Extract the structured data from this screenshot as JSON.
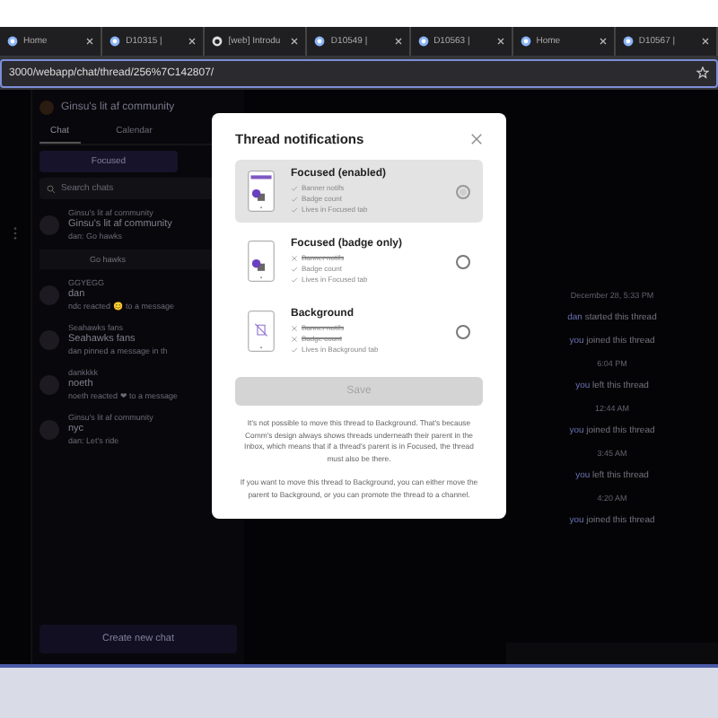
{
  "browser": {
    "tabs": [
      {
        "label": "Home",
        "kind": "app",
        "selected": false
      },
      {
        "label": "D10315 |",
        "kind": "app",
        "selected": false
      },
      {
        "label": "[web] Introdu",
        "kind": "github",
        "selected": false
      },
      {
        "label": "D10549 |",
        "kind": "app",
        "selected": false
      },
      {
        "label": "D10563 |",
        "kind": "app",
        "selected": false
      },
      {
        "label": "Home",
        "kind": "app",
        "selected": false
      },
      {
        "label": "D10567 |",
        "kind": "app",
        "selected": false
      }
    ],
    "address": "3000/webapp/chat/thread/256%7C142807/"
  },
  "sidebar": {
    "community": "Ginsu's lit af community",
    "tabs": [
      {
        "label": "Chat",
        "selected": true
      },
      {
        "label": "Calendar",
        "selected": false
      }
    ],
    "filter": "Focused",
    "search": {
      "placeholder": "Search chats"
    },
    "chats": [
      {
        "community": "Ginsu's lit af community",
        "name": "Ginsu's lit af community",
        "preview": "dan: Go hawks",
        "thread": "Go hawks"
      },
      {
        "community": "GGYEGG",
        "name": "dan",
        "preview": "ndc reacted 😊 to a message"
      },
      {
        "community": "Seahawks fans",
        "name": "Seahawks fans",
        "preview": "dan pinned a message in th"
      },
      {
        "community": "dankkkk",
        "name": "noeth",
        "preview": "noeth reacted ❤ to a message"
      },
      {
        "community": "Ginsu's lit af community",
        "name": "nyc",
        "preview": "dan: Let's ride"
      }
    ],
    "create_button": "Create new chat"
  },
  "thread": {
    "events": [
      {
        "kind": "time",
        "text": "December 28, 5:33 PM"
      },
      {
        "kind": "action",
        "actor": "dan",
        "text": "started this thread"
      },
      {
        "kind": "action",
        "actor": "you",
        "text": "joined this thread"
      },
      {
        "kind": "time",
        "text": "6:04 PM"
      },
      {
        "kind": "action",
        "actor": "you",
        "text": "left this thread"
      },
      {
        "kind": "time",
        "text": "12:44 AM"
      },
      {
        "kind": "action",
        "actor": "you",
        "text": "joined this thread"
      },
      {
        "kind": "time",
        "text": "3:45 AM"
      },
      {
        "kind": "action",
        "actor": "you",
        "text": "left this thread"
      },
      {
        "kind": "time",
        "text": "4:20 AM"
      },
      {
        "kind": "action",
        "actor": "you",
        "text": "joined this thread"
      }
    ]
  },
  "modal": {
    "title": "Thread notifications",
    "options": [
      {
        "kind": "focused",
        "title": "Focused (enabled)",
        "selected": true,
        "features": [
          {
            "text": "Banner notifs",
            "enabled": true
          },
          {
            "text": "Badge count",
            "enabled": true
          },
          {
            "text": "Lives in Focused tab",
            "enabled": true
          }
        ]
      },
      {
        "kind": "badge",
        "title": "Focused (badge only)",
        "selected": false,
        "features": [
          {
            "text": "Banner notifs",
            "enabled": false
          },
          {
            "text": "Badge count",
            "enabled": true
          },
          {
            "text": "Lives in Focused tab",
            "enabled": true
          }
        ]
      },
      {
        "kind": "background",
        "title": "Background",
        "selected": false,
        "features": [
          {
            "text": "Banner notifs",
            "enabled": false
          },
          {
            "text": "Badge count",
            "enabled": false
          },
          {
            "text": "Lives in Background tab",
            "enabled": true
          }
        ]
      }
    ],
    "save": {
      "label": "Save",
      "disabled": true
    },
    "paragraphs": [
      "It's not possible to move this thread to Background. That's because Comm's design always shows threads underneath their parent in the Inbox, which means that if a thread's parent is in Focused, the thread must also be there.",
      "If you want to move this thread to Background, you can either move the parent to Background, or you can promote the thread to a channel."
    ]
  }
}
